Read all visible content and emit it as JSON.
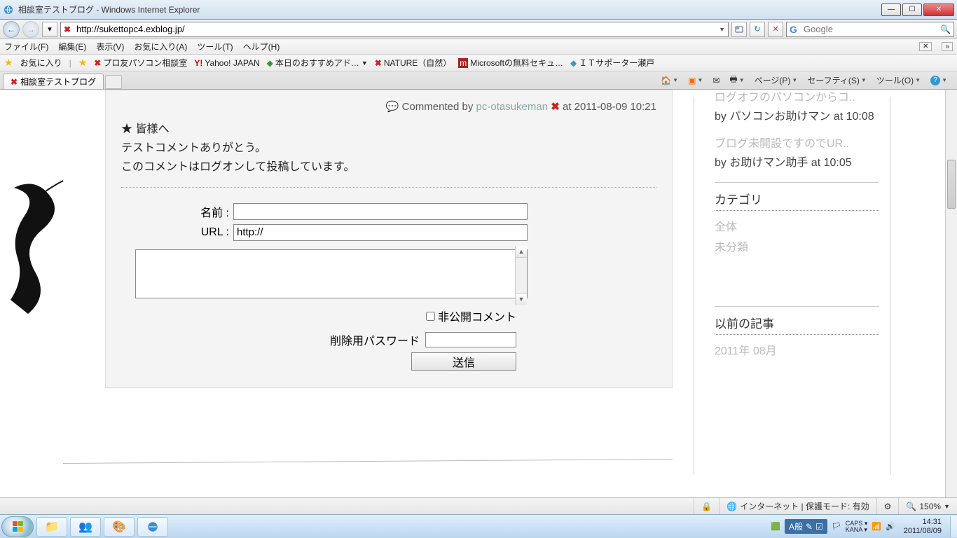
{
  "window": {
    "title": "相談室テストブログ - Windows Internet Explorer"
  },
  "nav": {
    "url": "http://sukettopc4.exblog.jp/"
  },
  "search": {
    "placeholder": "Google"
  },
  "menu": {
    "file": "ファイル(F)",
    "edit": "編集(E)",
    "view": "表示(V)",
    "fav": "お気に入り(A)",
    "tool": "ツール(T)",
    "help": "ヘルプ(H)"
  },
  "favbar": {
    "favlabel": "お気に入り",
    "items": [
      "プロ友パソコン相談室",
      "Yahoo! JAPAN",
      "本日のおすすめアド…",
      "NATURE（自然）",
      "Microsoftの無料セキュ…",
      "ＩＴサポーター瀬戸"
    ]
  },
  "tab": {
    "title": "相談室テストブログ"
  },
  "cmd": {
    "page": "ページ(P)",
    "safety": "セーフティ(S)",
    "tools": "ツール(O)"
  },
  "comment": {
    "prefix": "Commented by",
    "user": "pc-otasukeman",
    "at": "at 2011-08-09 10:21",
    "line1": "★ 皆様へ",
    "line2": "テストコメントありがとう。",
    "line3": "このコメントはログオンして投稿しています。"
  },
  "form": {
    "name": "名前 :",
    "url": "URL :",
    "urlval": "http://",
    "private": "非公開コメント",
    "delpw": "削除用パスワード",
    "send": "送信"
  },
  "side": {
    "link1": "ログオフのパソコンからコ..",
    "by1": "by パソコンお助けマン at 10:08",
    "link2": "ブログ未開設ですのでUR..",
    "by2": "by お助けマン助手 at 10:05",
    "catTitle": "カテゴリ",
    "cat1": "全体",
    "cat2": "未分類",
    "archTitle": "以前の記事",
    "arch1": "2011年 08月"
  },
  "status": {
    "zone": "インターネット | 保護モード: 有効",
    "zoom": "150%"
  },
  "tray": {
    "ime": "A般",
    "caps": "CAPS",
    "kana": "KANA",
    "time": "14:31",
    "date": "2011/08/09"
  }
}
